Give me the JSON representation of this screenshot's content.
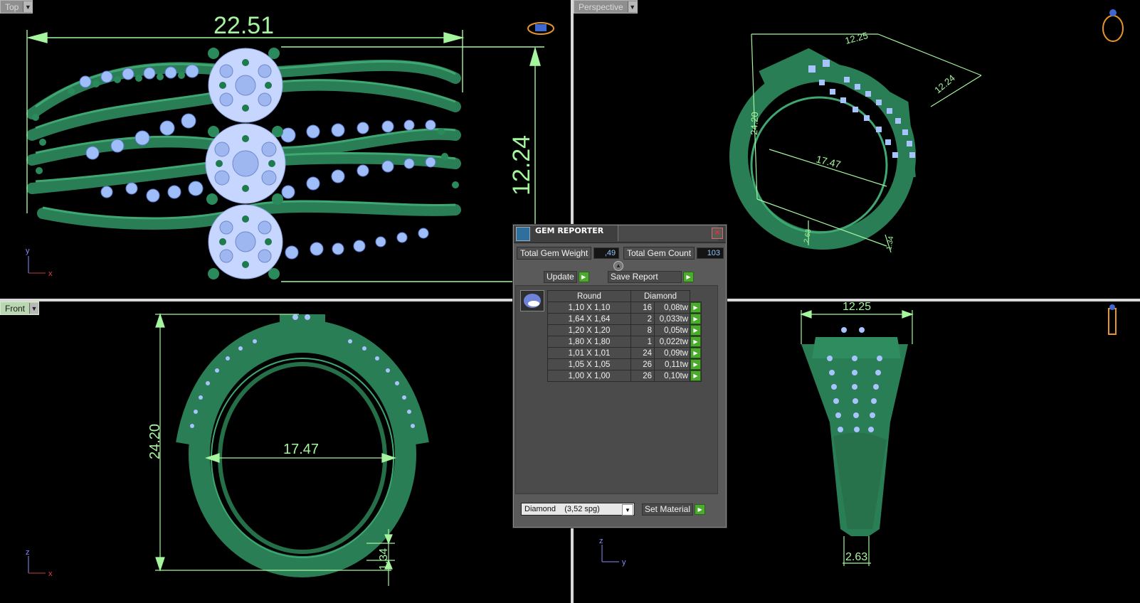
{
  "viewports": {
    "top": {
      "label": "Top",
      "dims": {
        "width": "22.51",
        "height": "12.24"
      },
      "axes": {
        "h": "x",
        "v": "y"
      }
    },
    "perspective": {
      "label": "Perspective",
      "dims": {
        "top": "12.25",
        "side": "12.24",
        "height": "24.20",
        "inner": "17.47",
        "left_small": "2.63",
        "right_small": "1.34"
      }
    },
    "front": {
      "label": "Front",
      "dims": {
        "height": "24.20",
        "inner": "17.47",
        "band": "1.34"
      },
      "axes": {
        "h": "x",
        "v": "z"
      }
    },
    "right": {
      "dims": {
        "top": "12.25",
        "bottom": "2.63"
      },
      "axes": {
        "h": "y",
        "v": "z"
      }
    }
  },
  "gem_reporter": {
    "title": "GEM REPORTER",
    "total_weight_label": "Total Gem Weight",
    "total_weight_value": ",49",
    "total_count_label": "Total Gem Count",
    "total_count_value": "103",
    "update_label": "Update",
    "save_label": "Save Report",
    "table": {
      "headers": [
        "Round",
        "Diamond"
      ],
      "rows": [
        {
          "size": "1,10 X 1,10",
          "count": "16",
          "weight": "0,08tw"
        },
        {
          "size": "1,64 X 1,64",
          "count": "2",
          "weight": "0,033tw"
        },
        {
          "size": "1,20 X 1,20",
          "count": "8",
          "weight": "0,05tw"
        },
        {
          "size": "1,80 X 1,80",
          "count": "1",
          "weight": "0,022tw"
        },
        {
          "size": "1,01 X 1,01",
          "count": "24",
          "weight": "0,09tw"
        },
        {
          "size": "1,05 X 1,05",
          "count": "26",
          "weight": "0,11tw"
        },
        {
          "size": "1,00 X 1,00",
          "count": "26",
          "weight": "0,10tw"
        }
      ]
    },
    "material_value": "Diamond    (3,52 spg)",
    "set_material_label": "Set Material"
  },
  "colors": {
    "metal": "#2e8a5e",
    "stone": "#a8c4ff",
    "dimension": "#a5f59e",
    "background": "#000000"
  }
}
